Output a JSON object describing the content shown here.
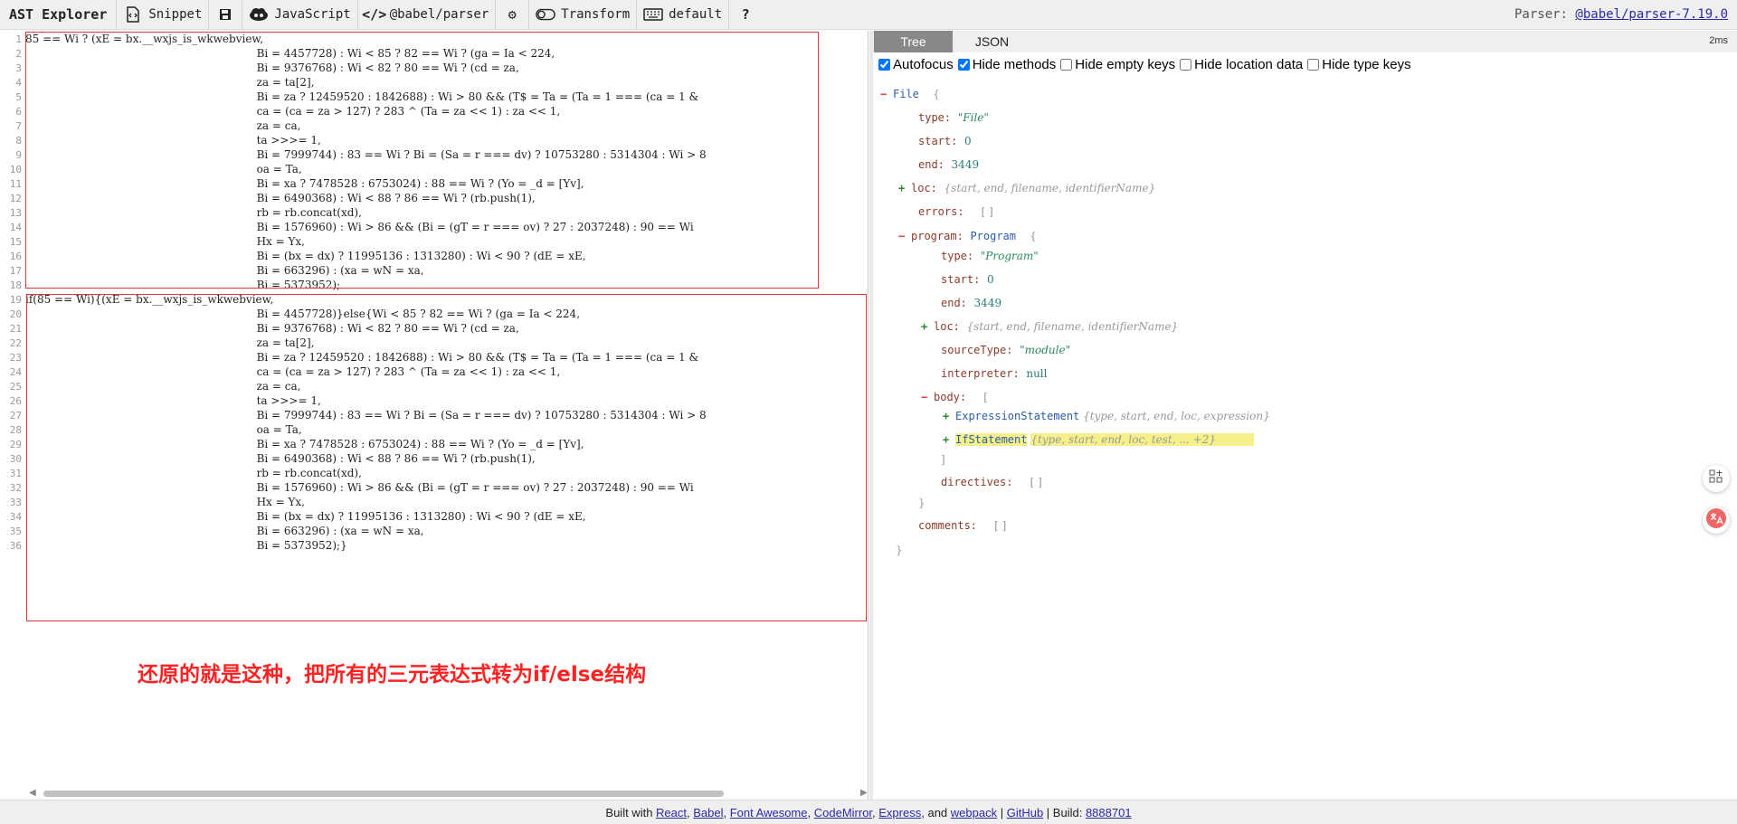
{
  "toolbar": {
    "brand": "AST Explorer",
    "snippet": "Snippet",
    "language": "JavaScript",
    "parser": "@babel/parser",
    "transform": "Transform",
    "keymap": "default",
    "help": "?",
    "parser_label": "Parser: ",
    "parser_link": "@babel/parser-7.19.0"
  },
  "editor": {
    "lines": [
      {
        "n": "1",
        "code": "85 == Wi ? (xE = bx.__wxjs_is_wkwebview,"
      },
      {
        "n": "2",
        "code": "                                                                   Bi = 4457728) : Wi < 85 ? 82 == Wi ? (ga = Ia < 224,"
      },
      {
        "n": "3",
        "code": "                                                                   Bi = 9376768) : Wi < 82 ? 80 == Wi ? (cd = za,"
      },
      {
        "n": "4",
        "code": "                                                                   za = ta[2],"
      },
      {
        "n": "5",
        "code": "                                                                   Bi = za ? 12459520 : 1842688) : Wi > 80 && (T$ = Ta = (Ta = 1 === (ca = 1 & "
      },
      {
        "n": "6",
        "code": "                                                                   ca = (ca = za > 127) ? 283 ^ (Ta = za << 1) : za << 1,"
      },
      {
        "n": "7",
        "code": "                                                                   za = ca,"
      },
      {
        "n": "8",
        "code": "                                                                   ta >>>= 1,"
      },
      {
        "n": "9",
        "code": "                                                                   Bi = 7999744) : 83 == Wi ? Bi = (Sa = r === dv) ? 10753280 : 5314304 : Wi > 8"
      },
      {
        "n": "10",
        "code": "                                                                   oa = Ta,"
      },
      {
        "n": "11",
        "code": "                                                                   Bi = xa ? 7478528 : 6753024) : 88 == Wi ? (Yo = _d = [Yv],"
      },
      {
        "n": "12",
        "code": "                                                                   Bi = 6490368) : Wi < 88 ? 86 == Wi ? (rb.push(1),"
      },
      {
        "n": "13",
        "code": "                                                                   rb = rb.concat(xd),"
      },
      {
        "n": "14",
        "code": "                                                                   Bi = 1576960) : Wi > 86 && (Bi = (gT = r === ov) ? 27 : 2037248) : 90 == Wi "
      },
      {
        "n": "15",
        "code": "                                                                   Hx = Yx,"
      },
      {
        "n": "16",
        "code": "                                                                   Bi = (bx = dx) ? 11995136 : 1313280) : Wi < 90 ? (dE = xE,"
      },
      {
        "n": "17",
        "code": "                                                                   Bi = 663296) : (xa = wN = xa,"
      },
      {
        "n": "18",
        "code": "                                                                   Bi = 5373952);"
      },
      {
        "n": "19",
        "code": "if(85 == Wi){(xE = bx.__wxjs_is_wkwebview,"
      },
      {
        "n": "20",
        "code": "                                                                   Bi = 4457728)}else{Wi < 85 ? 82 == Wi ? (ga = Ia < 224,"
      },
      {
        "n": "21",
        "code": "                                                                   Bi = 9376768) : Wi < 82 ? 80 == Wi ? (cd = za,"
      },
      {
        "n": "22",
        "code": "                                                                   za = ta[2],"
      },
      {
        "n": "23",
        "code": "                                                                   Bi = za ? 12459520 : 1842688) : Wi > 80 && (T$ = Ta = (Ta = 1 === (ca = 1 & "
      },
      {
        "n": "24",
        "code": "                                                                   ca = (ca = za > 127) ? 283 ^ (Ta = za << 1) : za << 1,"
      },
      {
        "n": "25",
        "code": "                                                                   za = ca,"
      },
      {
        "n": "26",
        "code": "                                                                   ta >>>= 1,"
      },
      {
        "n": "27",
        "code": "                                                                   Bi = 7999744) : 83 == Wi ? Bi = (Sa = r === dv) ? 10753280 : 5314304 : Wi > 8"
      },
      {
        "n": "28",
        "code": "                                                                   oa = Ta,"
      },
      {
        "n": "29",
        "code": "                                                                   Bi = xa ? 7478528 : 6753024) : 88 == Wi ? (Yo = _d = [Yv],"
      },
      {
        "n": "30",
        "code": "                                                                   Bi = 6490368) : Wi < 88 ? 86 == Wi ? (rb.push(1),"
      },
      {
        "n": "31",
        "code": "                                                                   rb = rb.concat(xd),"
      },
      {
        "n": "32",
        "code": "                                                                   Bi = 1576960) : Wi > 86 && (Bi = (gT = r === ov) ? 27 : 2037248) : 90 == Wi "
      },
      {
        "n": "33",
        "code": "                                                                   Hx = Yx,"
      },
      {
        "n": "34",
        "code": "                                                                   Bi = (bx = dx) ? 11995136 : 1313280) : Wi < 90 ? (dE = xE,"
      },
      {
        "n": "35",
        "code": "                                                                   Bi = 663296) : (xa = wN = xa,"
      },
      {
        "n": "36",
        "code": "                                                                   Bi = 5373952);}"
      }
    ],
    "annotation": "还原的就是这种，把所有的三元表达式转为if/else结构"
  },
  "tree_panel": {
    "tabs": [
      "Tree",
      "JSON"
    ],
    "active_tab": "Tree",
    "parse_time": "2ms",
    "options": [
      {
        "label": "Autofocus",
        "checked": true
      },
      {
        "label": "Hide methods",
        "checked": true
      },
      {
        "label": "Hide empty keys",
        "checked": false
      },
      {
        "label": "Hide location data",
        "checked": false
      },
      {
        "label": "Hide type keys",
        "checked": false
      }
    ],
    "nodes": [
      {
        "toggle": "−",
        "kind": "minus",
        "key": "",
        "type": "File",
        "value": "",
        "vclass": "",
        "summary": "",
        "bracket": "{"
      },
      {
        "toggle": "",
        "kind": "",
        "key": "type:",
        "type": "",
        "value": "\"File\"",
        "vclass": "str",
        "summary": "",
        "bracket": ""
      },
      {
        "toggle": "",
        "kind": "",
        "key": "start:",
        "type": "",
        "value": "0",
        "vclass": "num",
        "summary": "",
        "bracket": ""
      },
      {
        "toggle": "",
        "kind": "",
        "key": "end:",
        "type": "",
        "value": "3449",
        "vclass": "num",
        "summary": "",
        "bracket": ""
      },
      {
        "toggle": "+",
        "kind": "plus",
        "key": "loc:",
        "type": "",
        "value": "",
        "vclass": "",
        "summary": "{start, end, filename, identifierName}",
        "bracket": ""
      },
      {
        "toggle": "",
        "kind": "",
        "key": "errors:",
        "type": "",
        "value": "",
        "vclass": "",
        "summary": "",
        "bracket": "[ ]"
      },
      {
        "toggle": "−",
        "kind": "minus",
        "key": "program:",
        "type": "Program",
        "value": "",
        "vclass": "",
        "summary": "",
        "bracket": "{"
      },
      {
        "toggle": "",
        "kind": "",
        "key": "type:",
        "type": "",
        "value": "\"Program\"",
        "vclass": "str",
        "summary": "",
        "bracket": ""
      },
      {
        "toggle": "",
        "kind": "",
        "key": "start:",
        "type": "",
        "value": "0",
        "vclass": "num",
        "summary": "",
        "bracket": ""
      },
      {
        "toggle": "",
        "kind": "",
        "key": "end:",
        "type": "",
        "value": "3449",
        "vclass": "num",
        "summary": "",
        "bracket": ""
      },
      {
        "toggle": "+",
        "kind": "plus",
        "key": "loc:",
        "type": "",
        "value": "",
        "vclass": "",
        "summary": "{start, end, filename, identifierName}",
        "bracket": ""
      },
      {
        "toggle": "",
        "kind": "",
        "key": "sourceType:",
        "type": "",
        "value": "\"module\"",
        "vclass": "str",
        "summary": "",
        "bracket": ""
      },
      {
        "toggle": "",
        "kind": "",
        "key": "interpreter:",
        "type": "",
        "value": "null",
        "vclass": "num",
        "summary": "",
        "bracket": ""
      },
      {
        "toggle": "−",
        "kind": "minus",
        "key": "body:",
        "type": "",
        "value": "",
        "vclass": "",
        "summary": "",
        "bracket": "["
      },
      {
        "toggle": "+",
        "kind": "plus",
        "key": "",
        "type": "ExpressionStatement",
        "value": "",
        "vclass": "",
        "summary": "{type, start, end, loc, expression}",
        "bracket": ""
      },
      {
        "toggle": "+",
        "kind": "plus",
        "key": "",
        "type": "IfStatement",
        "value": "",
        "vclass": "",
        "summary": "{type, start, end, loc, test, ... +2}",
        "bracket": ""
      },
      {
        "toggle": "",
        "kind": "",
        "key": "",
        "type": "",
        "value": "",
        "vclass": "",
        "summary": "",
        "bracket": "]"
      },
      {
        "toggle": "",
        "kind": "",
        "key": "directives:",
        "type": "",
        "value": "",
        "vclass": "",
        "summary": "",
        "bracket": "[ ]"
      },
      {
        "toggle": "",
        "kind": "",
        "key": "",
        "type": "",
        "value": "",
        "vclass": "",
        "summary": "",
        "bracket": "}"
      },
      {
        "toggle": "",
        "kind": "",
        "key": "comments:",
        "type": "",
        "value": "",
        "vclass": "",
        "summary": "",
        "bracket": "[ ]"
      },
      {
        "toggle": "",
        "kind": "",
        "key": "",
        "type": "",
        "value": "",
        "vclass": "",
        "summary": "",
        "bracket": "}"
      }
    ]
  },
  "footer": {
    "prefix": "Built with ",
    "links": [
      "React",
      "Babel",
      "Font Awesome",
      "CodeMirror",
      "Express",
      "webpack"
    ],
    "and_text": "and",
    "github": "GitHub",
    "build_label": "Build:",
    "build_id": "8888701"
  },
  "icons": {
    "snippet": "code-file-icon",
    "save": "save-icon",
    "language": "cloud-icon",
    "parser": "code-brackets-icon",
    "settings": "gear-icon",
    "transform": "toggle-icon",
    "keymap": "keyboard-icon",
    "help": "help-icon"
  }
}
